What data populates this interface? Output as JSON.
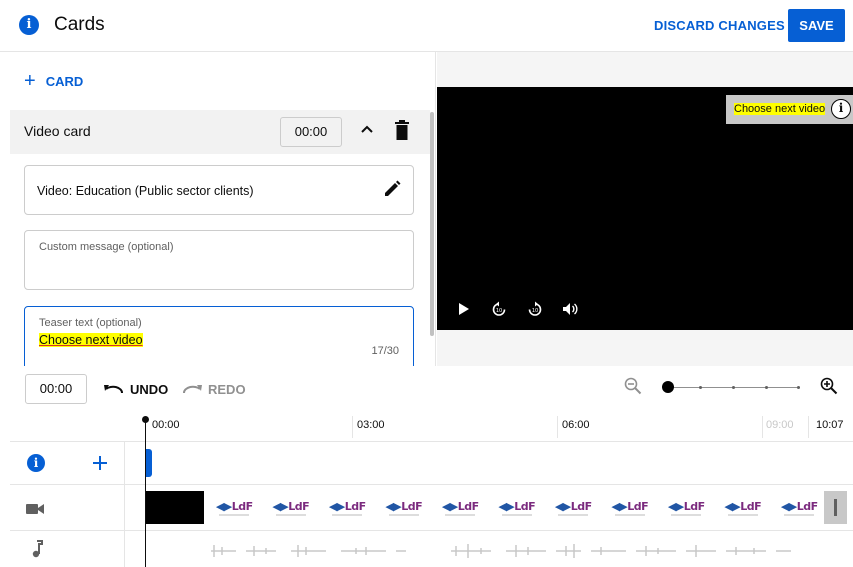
{
  "header": {
    "title": "Cards",
    "discard_label": "DISCARD CHANGES",
    "save_label": "SAVE"
  },
  "left_panel": {
    "add_card_label": "CARD",
    "card": {
      "type_label": "Video card",
      "time": "00:00",
      "video_field": "Video: Education (Public sector clients)",
      "custom_message_placeholder": "Custom message (optional)",
      "teaser_placeholder": "Teaser text (optional)",
      "teaser_value": "Choose next video",
      "teaser_count": "17/30"
    }
  },
  "preview": {
    "teaser_text": "Choose next video"
  },
  "toolbar": {
    "time": "00:00",
    "undo_label": "UNDO",
    "redo_label": "REDO"
  },
  "timeline": {
    "ruler": [
      "00:00",
      "03:00",
      "06:00",
      "09:00",
      "10:07"
    ]
  },
  "colors": {
    "accent": "#065fd4",
    "highlight": "#ffff00"
  },
  "icons": [
    "info-icon",
    "plus-icon",
    "chevron-up-icon",
    "trash-icon",
    "pencil-icon",
    "play-icon",
    "rewind-10-icon",
    "forward-10-icon",
    "volume-icon",
    "undo-icon",
    "redo-icon",
    "zoom-out-icon",
    "zoom-in-icon",
    "video-camera-icon",
    "music-note-icon"
  ]
}
